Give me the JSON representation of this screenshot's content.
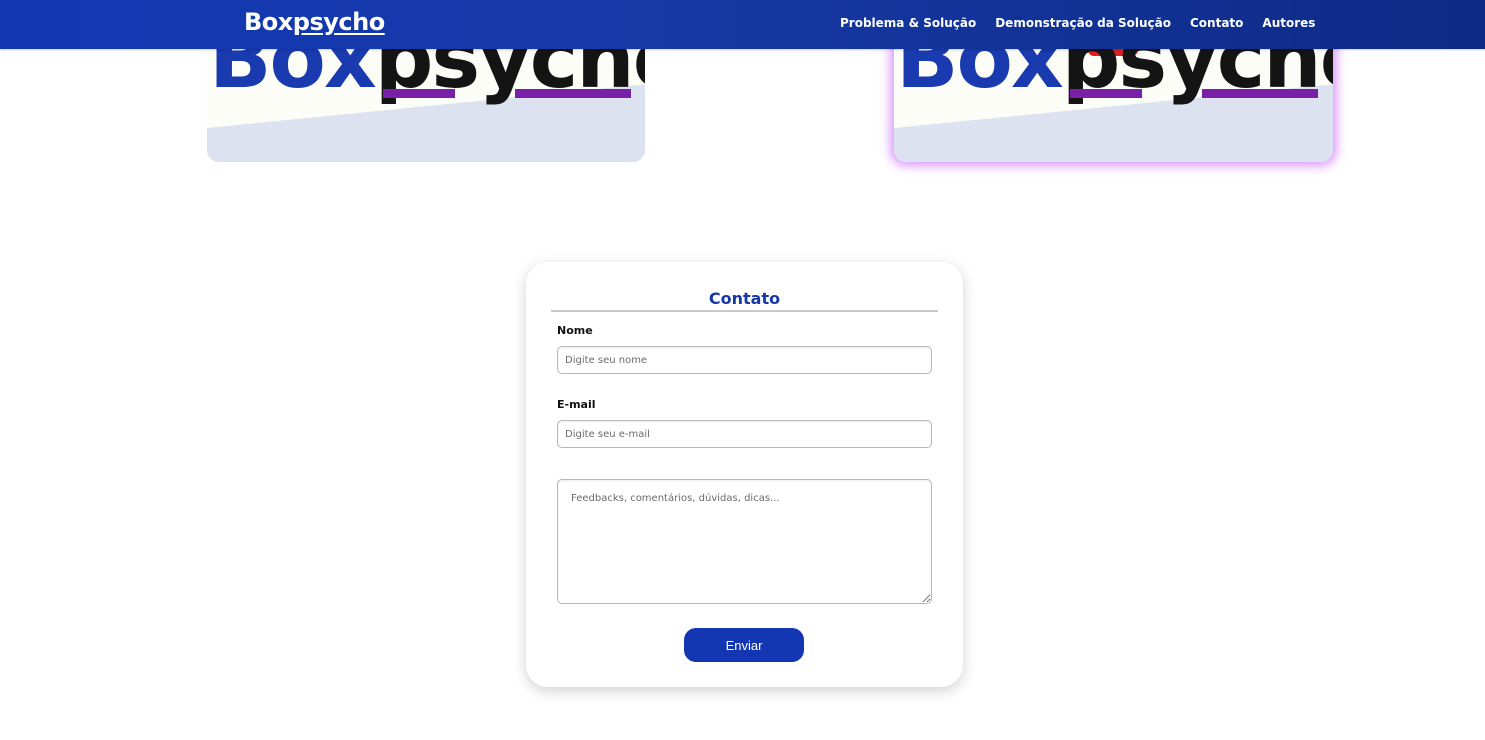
{
  "nav": {
    "brand_prefix": "Box",
    "brand_underlined": "psycho",
    "links": [
      {
        "label": "Problema & Solução"
      },
      {
        "label": "Demonstração da Solução"
      },
      {
        "label": "Contato"
      },
      {
        "label": "Autores"
      }
    ],
    "background_color": "#1337b3"
  },
  "logo_cards": [
    {
      "text_box": "Box",
      "text_psy": "psy",
      "text_cho": "cho",
      "highlighted": false
    },
    {
      "text_box": "Box",
      "text_psy": "psy",
      "text_cho": "cho",
      "highlighted": true
    }
  ],
  "contact": {
    "title": "Contato",
    "name_label": "Nome",
    "name_placeholder": "Digite seu nome",
    "email_label": "E-mail",
    "email_placeholder": "Digite seu e-mail",
    "message_placeholder": "Feedbacks, comentários, dúvidas, dicas...",
    "submit_label": "Enviar"
  },
  "colors": {
    "accent": "#1337b3",
    "title": "#1737a8",
    "logo_purple": "#7a1fa8",
    "highlight_glow": "#d278ff"
  }
}
